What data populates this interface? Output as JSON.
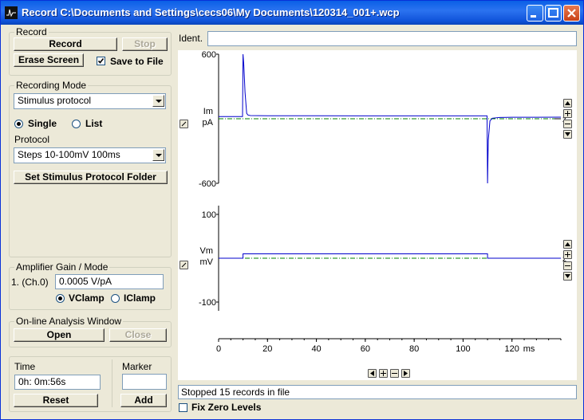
{
  "window": {
    "title": "Record C:\\Documents and Settings\\cecs06\\My Documents\\120314_001+.wcp"
  },
  "record": {
    "legend": "Record",
    "record_label": "Record",
    "stop_label": "Stop",
    "erase_label": "Erase Screen",
    "save_label": "Save to File",
    "save_checked": true
  },
  "mode": {
    "legend": "Recording Mode",
    "selected": "Stimulus protocol",
    "single_label": "Single",
    "list_label": "List",
    "protocol_label": "Protocol",
    "protocol_selected": "Steps 10-100mV 100ms",
    "set_folder_label": "Set Stimulus Protocol Folder"
  },
  "amp": {
    "legend": "Amplifier Gain / Mode",
    "channel_label": "1. (Ch.0)",
    "gain_value": "0.0005 V/pA",
    "vclamp_label": "VClamp",
    "iclamp_label": "IClamp"
  },
  "analysis": {
    "legend": "On-line Analysis Window",
    "open_label": "Open",
    "close_label": "Close"
  },
  "time": {
    "label": "Time",
    "value": "0h: 0m:56s",
    "reset_label": "Reset"
  },
  "marker": {
    "label": "Marker",
    "value": "",
    "add_label": "Add"
  },
  "ident": {
    "label": "Ident.",
    "value": ""
  },
  "status": {
    "text": "Stopped 15 records in file"
  },
  "fix_zero": {
    "label": "Fix Zero Levels",
    "checked": false
  },
  "chart_data": [
    {
      "type": "line",
      "channel": "Im",
      "unit": "pA",
      "ylabel": "Im pA",
      "yticks": [
        600,
        -600
      ],
      "ylim": [
        -600,
        600
      ],
      "xlim": [
        0,
        140
      ],
      "series": [
        {
          "name": "Im",
          "color": "#0000CC",
          "x": [
            0,
            9.8,
            10,
            10.3,
            10.8,
            11.5,
            12,
            13,
            20,
            40,
            60,
            80,
            100,
            109.8,
            110,
            110.3,
            111,
            112,
            115,
            120,
            130,
            140
          ],
          "y": [
            20,
            20,
            600,
            500,
            250,
            50,
            35,
            30,
            28,
            28,
            27,
            27,
            27,
            27,
            -600,
            -200,
            -20,
            5,
            12,
            14,
            14,
            15
          ]
        }
      ],
      "zero_level": 0,
      "zero_color": "#008000",
      "grid": false
    },
    {
      "type": "line",
      "channel": "Vm",
      "unit": "mV",
      "ylabel": "Vm mV",
      "yticks": [
        100,
        -100
      ],
      "ylim": [
        -120,
        120
      ],
      "xlim": [
        0,
        140
      ],
      "xlabel": "ms",
      "xticks": [
        0,
        20,
        40,
        60,
        80,
        100,
        120
      ],
      "series": [
        {
          "name": "Vm",
          "color": "#0000CC",
          "x": [
            0,
            10,
            10,
            110,
            110,
            140
          ],
          "y": [
            0,
            0,
            10,
            10,
            0,
            0
          ]
        }
      ],
      "zero_level": 0,
      "zero_color": "#008000",
      "grid": false
    }
  ]
}
